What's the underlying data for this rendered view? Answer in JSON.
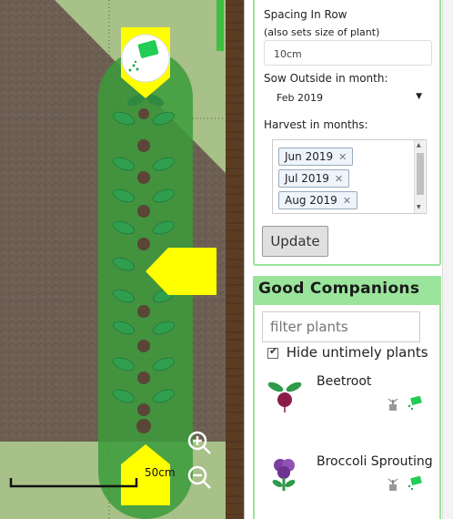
{
  "form": {
    "spacing_label": "Spacing In Row",
    "spacing_note": "(also sets size of plant)",
    "spacing_value": "10cm",
    "sow_label": "Sow Outside in month:",
    "sow_value": "Feb 2019",
    "harvest_label": "Harvest in months:",
    "harvest_tags": [
      "Jun 2019",
      "Jul 2019",
      "Aug 2019"
    ],
    "update_label": "Update"
  },
  "companions": {
    "title": "Good Companions",
    "filter_placeholder": "filter plants",
    "hide_label": "Hide untimely plants",
    "hide_checked": true,
    "plants": [
      {
        "name": "Beetroot",
        "icon": "beetroot-icon"
      },
      {
        "name": "Broccoli Sprouting",
        "icon": "broccoli-icon"
      }
    ]
  },
  "map": {
    "scale_label": "50cm",
    "zoom_in_icon": "zoom-in-icon",
    "zoom_out_icon": "zoom-out-icon"
  },
  "colors": {
    "accent_green": "#9be49b",
    "highlight_yellow": "#ffff00",
    "row_green": "#3b9b3b"
  }
}
